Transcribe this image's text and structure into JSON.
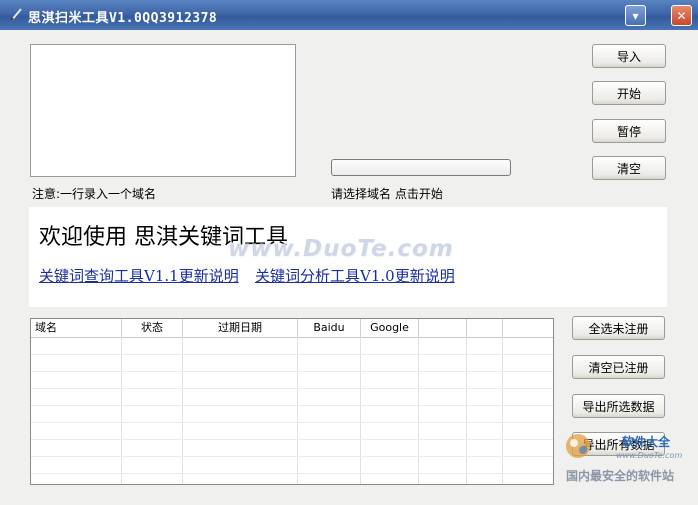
{
  "window": {
    "title": "思淇扫米工具V1.0QQ3912378",
    "minimize_label": "▾",
    "close_label": "✕"
  },
  "left_panel": {
    "domain_input_value": "",
    "hint": "注意:一行录入一个域名"
  },
  "status": {
    "text": "请选择域名 点击开始",
    "progress": 0
  },
  "buttons": {
    "import": "导入",
    "start": "开始",
    "pause": "暂停",
    "clear": "清空",
    "select_unregistered": "全选未注册",
    "clear_registered": "清空已注册",
    "export_selected": "导出所选数据",
    "export_all": "导出所有数据"
  },
  "banner": {
    "welcome": "欢迎使用 思淇关键词工具",
    "link1": "关键词查询工具V1.1更新说明",
    "link2": "关键词分析工具V1.0更新说明",
    "watermark": "www.DuoTe.com"
  },
  "table": {
    "columns": [
      "域名",
      "状态",
      "过期日期",
      "Baidu",
      "Google",
      "",
      ""
    ],
    "rows": []
  },
  "corner_watermark": {
    "line1": "软件大全",
    "line2": "www.DuoTe.com",
    "line3": "国内最安全的软件站"
  }
}
